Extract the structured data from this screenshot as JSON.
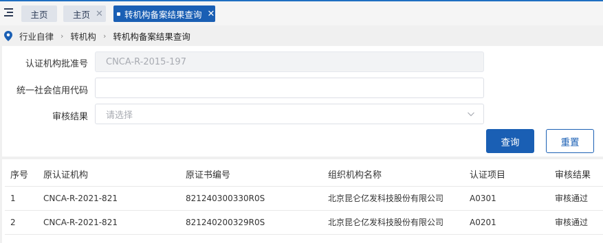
{
  "tabs": [
    {
      "label": "主页",
      "closable": false,
      "active": false
    },
    {
      "label": "主页",
      "closable": true,
      "active": false
    },
    {
      "label": "转机构备案结果查询",
      "closable": true,
      "active": true
    }
  ],
  "close_glyph": "✕",
  "breadcrumb": {
    "items": [
      "行业自律",
      "转机构",
      "转机构备案结果查询"
    ],
    "separator": "›"
  },
  "form": {
    "cert_approval_no": {
      "label": "认证机构批准号",
      "value": "CNCA-R-2015-197",
      "disabled": true
    },
    "credit_code": {
      "label": "统一社会信用代码",
      "value": "",
      "placeholder": ""
    },
    "review_result": {
      "label": "审核结果",
      "placeholder": "请选择"
    },
    "search_button": "查询",
    "reset_button": "重置"
  },
  "table": {
    "columns": [
      "序号",
      "原认证机构",
      "原证书编号",
      "组织机构名称",
      "认证项目",
      "审核结果"
    ],
    "rows": [
      [
        "1",
        "CNCA-R-2021-821",
        "821240300330R0S",
        "北京昆仑亿发科技股份有限公司",
        "A0301",
        "审核通过"
      ],
      [
        "2",
        "CNCA-R-2021-821",
        "821240200329R0S",
        "北京昆仑亿发科技股份有限公司",
        "A0201",
        "审核通过"
      ]
    ]
  },
  "colors": {
    "primary": "#1a5fb4",
    "tab_inactive": "#dfe3ea"
  }
}
